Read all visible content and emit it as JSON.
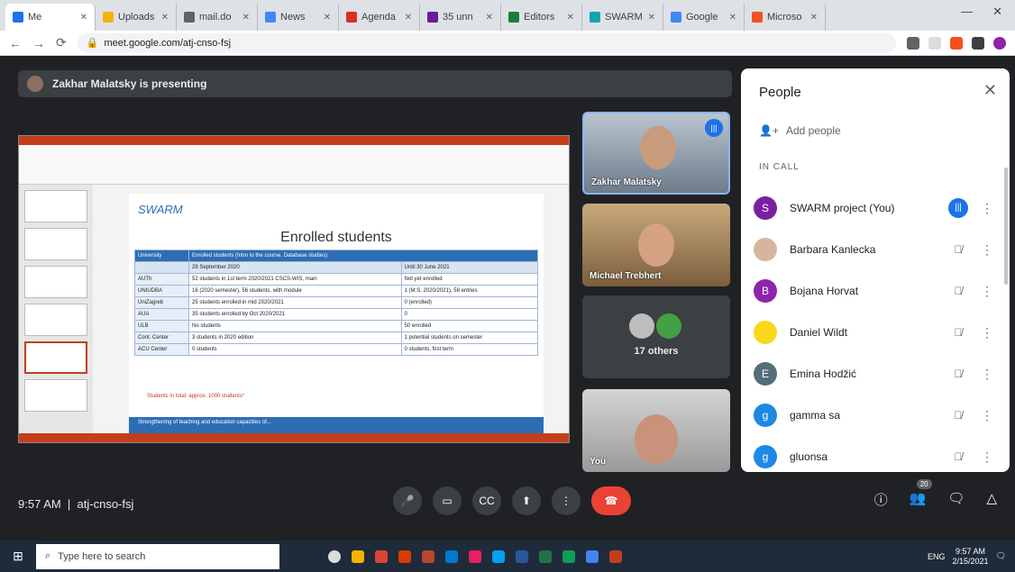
{
  "browser": {
    "tabs": [
      {
        "label": "Me",
        "color": "#1a73e8",
        "active": true
      },
      {
        "label": "Uploads",
        "color": "#f4b400"
      },
      {
        "label": "mail.do",
        "color": "#5f6368"
      },
      {
        "label": "News",
        "color": "#4285f4"
      },
      {
        "label": "Agenda",
        "color": "#d93025"
      },
      {
        "label": "35 unn",
        "color": "#6a1b9a"
      },
      {
        "label": "Editors",
        "color": "#188038"
      },
      {
        "label": "SWARM",
        "color": "#12a4af"
      },
      {
        "label": "Google",
        "color": "#4285f4"
      },
      {
        "label": "Microso",
        "color": "#f25022"
      }
    ],
    "url": "meet.google.com/atj-cnso-fsj"
  },
  "meet": {
    "presenter_banner": "Zakhar Malatsky is presenting",
    "slide": {
      "logo": "SWARM",
      "title": "Enrolled students",
      "header_left": "University",
      "header_right": "Enrolled students (Intro to the course, Database studies)",
      "sub_left": "29 September 2020",
      "sub_right": "Until 30 June 2021",
      "rows": [
        {
          "u": "AUTh",
          "a": "52 students in 1st term 2020/2021 CSCS-WIS, main",
          "b": "Not yet enrolled"
        },
        {
          "u": "UNIUDBA",
          "a": "16 (2020 semester), 56 students, with module",
          "b": "1 (M.S. 2020/2021), 58 entries"
        },
        {
          "u": "UniZagreb",
          "a": "25 students enrolled in mid 2020/2021",
          "b": "0 (enrolled)"
        },
        {
          "u": "AUA",
          "a": "35 students enrolled by Oct 2020/2021",
          "b": "0"
        },
        {
          "u": "ULB",
          "a": "No students",
          "b": "50 enrolled"
        },
        {
          "u": "Cont. Center",
          "a": "3 students in 2020 edition",
          "b": "1 potential students on semester"
        },
        {
          "u": "ACU Center",
          "a": "0 students",
          "b": "0 students, first term"
        }
      ],
      "note": "Students in total: approx. 1000 students*",
      "footer": "Strengthening of teaching and education capacities of..."
    },
    "participants": [
      {
        "name": "Zakhar Malatsky"
      },
      {
        "name": "Michael Trebhert"
      },
      {
        "name": "17 others"
      },
      {
        "name": "You"
      }
    ],
    "people_panel": {
      "title": "People",
      "add_people": "Add people",
      "section_label": "IN CALL",
      "people": [
        {
          "name": "SWARM project (You)",
          "initial": "S",
          "color": "#7b1fa2",
          "mic": "speaking"
        },
        {
          "name": "Barbara Kanlecka",
          "initial": "",
          "color": "#d7b49e",
          "mic": "muted"
        },
        {
          "name": "Bojana Horvat",
          "initial": "B",
          "color": "#8e24aa",
          "mic": "muted"
        },
        {
          "name": "Daniel Wildt",
          "initial": "",
          "color": "#f9d71c",
          "mic": "muted"
        },
        {
          "name": "Emina Hodžić",
          "initial": "E",
          "color": "#546e7a",
          "mic": "muted"
        },
        {
          "name": "gamma sa",
          "initial": "g",
          "color": "#1e88e5",
          "mic": "muted"
        },
        {
          "name": "gluonsa",
          "initial": "g",
          "color": "#1e88e5",
          "mic": "muted"
        }
      ]
    },
    "bottom_bar": {
      "time": "9:57 AM",
      "meeting_code": "atj-cnso-fsj",
      "participant_count": "20"
    }
  },
  "taskbar": {
    "search_placeholder": "Type here to search",
    "tray_text": "ENG",
    "clock_time": "9:57 AM",
    "clock_date": "2/15/2021"
  }
}
